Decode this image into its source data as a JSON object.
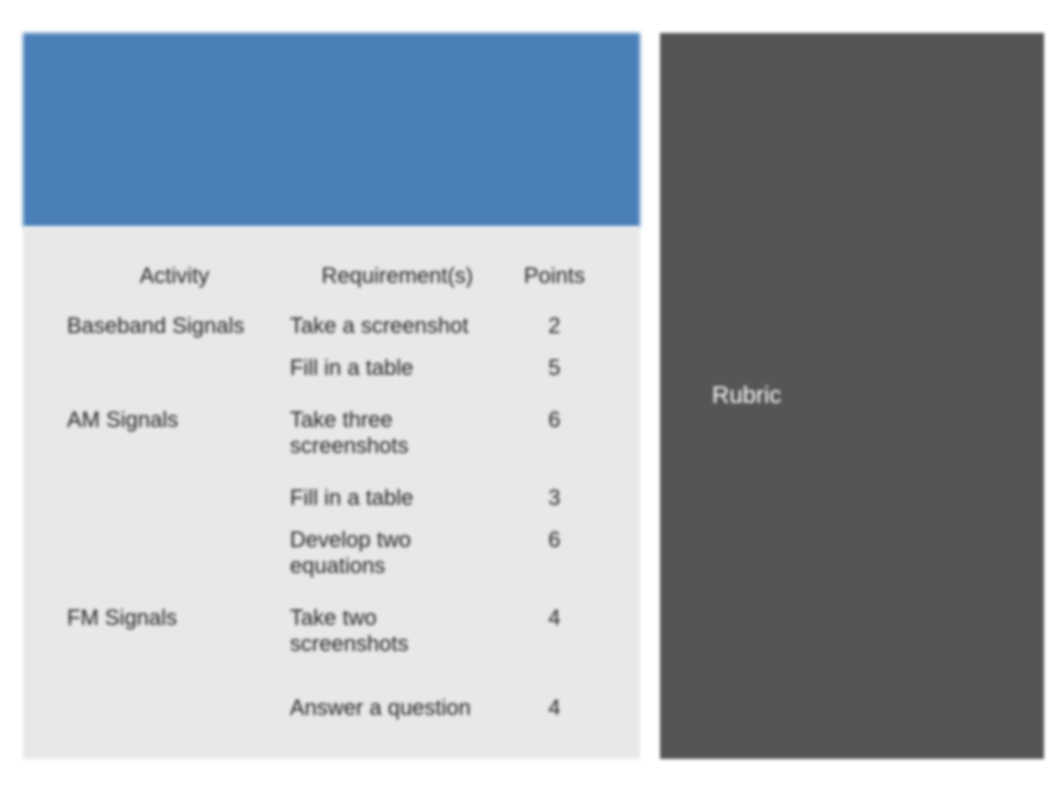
{
  "sidebar": {
    "label": "Rubric"
  },
  "table": {
    "headers": {
      "activity": "Activity",
      "requirement": "Requirement(s)",
      "points": "Points"
    },
    "rows": [
      {
        "activity": "Baseband Signals",
        "requirement": "Take a screenshot",
        "points": "2",
        "groupStart": true
      },
      {
        "activity": "",
        "requirement": "Fill in a table",
        "points": "5"
      },
      {
        "activity": "AM Signals",
        "requirement": "Take three screenshots",
        "points": "6",
        "groupStart": true
      },
      {
        "activity": "",
        "requirement": "Fill in a table",
        "points": "3",
        "midGap": true
      },
      {
        "activity": "",
        "requirement": "Develop two equations",
        "points": "6"
      },
      {
        "activity": "FM Signals",
        "requirement": "Take two screenshots",
        "points": "4",
        "groupStart": true
      },
      {
        "activity": "",
        "requirement": "Answer a question",
        "points": "4",
        "extraGap": true
      }
    ]
  }
}
